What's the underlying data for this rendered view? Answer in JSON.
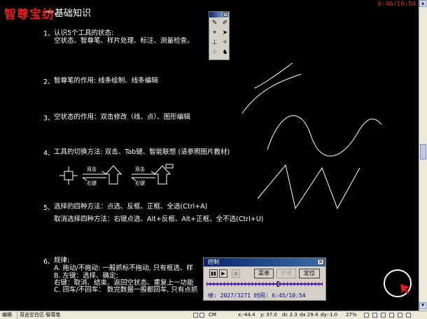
{
  "logo": "智尊宝纺",
  "clock": "6:46/10:54",
  "title_num": "一、",
  "title": "基础知识",
  "items": [
    {
      "num": "1、",
      "text": "认识5个工具的状态:",
      "sub": "空状态、智尊笔、样片处理、标注、测量检查。"
    },
    {
      "num": "2、",
      "text": "智尊笔的作用:  线条绘制、线条编辑"
    },
    {
      "num": "3、",
      "text": "空状态的作用：双击修改（线、点）、图形编辑"
    },
    {
      "num": "4、",
      "text": "工具的切换方法:  双击、Tab键、智能联想 (请参照图片教材)"
    },
    {
      "num": "5、",
      "text": "选择的四种方法：点选、反框、正框、全选(Ctrl+A)",
      "sub": "取消选择四种方法：右键点选、Alt+反框、Alt+正框、全不选(Ctrl+U)"
    },
    {
      "num": "6、",
      "text": "规律:",
      "lines": [
        "A. 拖动/不拖动:  一般抓标不拖动, 只有框选、样",
        "B. 左键：选择、确定;",
        "     右键：取消、结束、返回空状态、重复上一功能",
        "C. 回车/不回车：  数完数据一般都回车, 只有点抓"
      ]
    }
  ],
  "diagram": {
    "left_label_top": "双击",
    "left_label_bottom": "右键",
    "right_label_top": "双击",
    "right_label_bottom": "右键"
  },
  "palette": {
    "close": "×"
  },
  "control": {
    "title": "控制",
    "close": "×",
    "menu_label": "菜单",
    "step_label": "步骤",
    "locate_label": "定位",
    "info": "帧: 2027/3271 时间: 6:45/10:54",
    "progress": 0.62
  },
  "status": {
    "mode": "编辑",
    "hint": "双击空白区-智尊笔",
    "cm": "CM",
    "x": "x:-44.4",
    "y": "y: 37.0",
    "dc": "dc 2.3",
    "dx": "dx 29.4",
    "dy": "dy:-1.0",
    "zoom": "27%"
  }
}
